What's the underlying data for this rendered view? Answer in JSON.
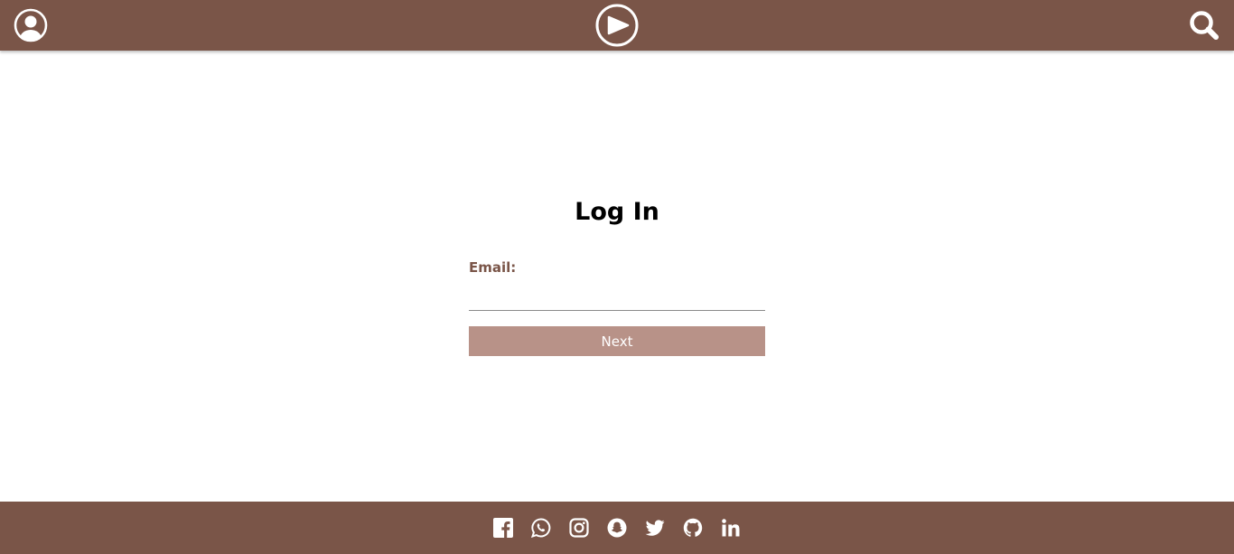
{
  "header": {
    "user_icon": "user-circle-icon",
    "logo_icon": "play-circle-icon",
    "search_icon": "search-icon"
  },
  "login": {
    "title": "Log In",
    "email_label": "Email:",
    "email_value": "",
    "next_label": "Next"
  },
  "footer": {
    "social_icons": [
      "facebook-icon",
      "whatsapp-icon",
      "instagram-icon",
      "snapchat-icon",
      "twitter-icon",
      "github-icon",
      "linkedin-icon"
    ]
  },
  "colors": {
    "brand_brown": "#7a5548",
    "button_bg": "#b89288",
    "label_color": "#7a5548"
  }
}
